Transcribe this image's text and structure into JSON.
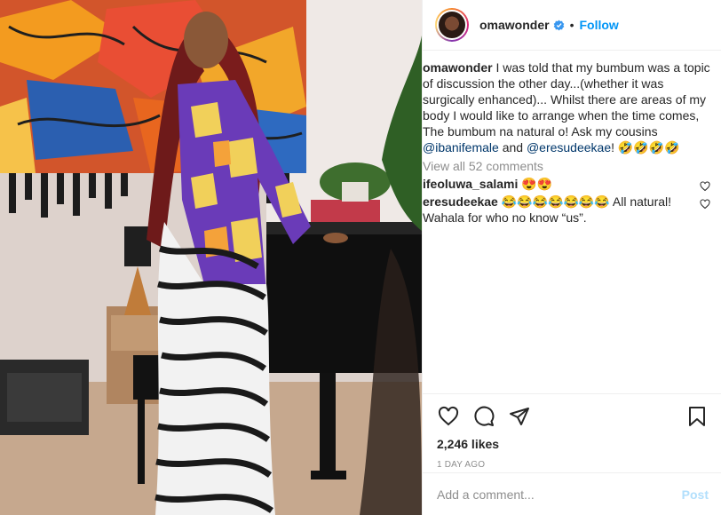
{
  "header": {
    "username": "omawonder",
    "separator": "•",
    "follow_label": "Follow"
  },
  "caption": {
    "username": "omawonder",
    "text_1": " I was told that my bumbum was a topic of discussion the other day...(whether it was surgically enhanced)... Whilst there are areas of my body I would like to arrange when the time comes, The bumbum na natural o! Ask my cousins ",
    "mention_1": "@ibanifemale",
    "text_2": " and ",
    "mention_2": "@eresudeekae",
    "text_3": "! 🤣🤣🤣🤣"
  },
  "view_all_comments": "View all 52 comments",
  "comments": [
    {
      "username": "ifeoluwa_salami",
      "text": " 😍😍"
    },
    {
      "username": "eresudeekae",
      "text": " 😂😂😂😂😂😂😂 All natural! Wahala for who no know “us”."
    }
  ],
  "footer": {
    "likes": "2,246 likes",
    "timestamp": "1 DAY AGO"
  },
  "add_comment": {
    "placeholder": "Add a comment...",
    "post_label": "Post"
  },
  "icons": {
    "verified": "verified-badge-icon",
    "like": "heart-icon",
    "comment": "comment-bubble-icon",
    "share": "paper-plane-icon",
    "save": "bookmark-icon",
    "comment_like": "small-heart-icon"
  },
  "colors": {
    "link_blue": "#0095f6",
    "mention": "#00376b",
    "muted": "#8e8e8e",
    "post_disabled": "#b2dffc"
  }
}
